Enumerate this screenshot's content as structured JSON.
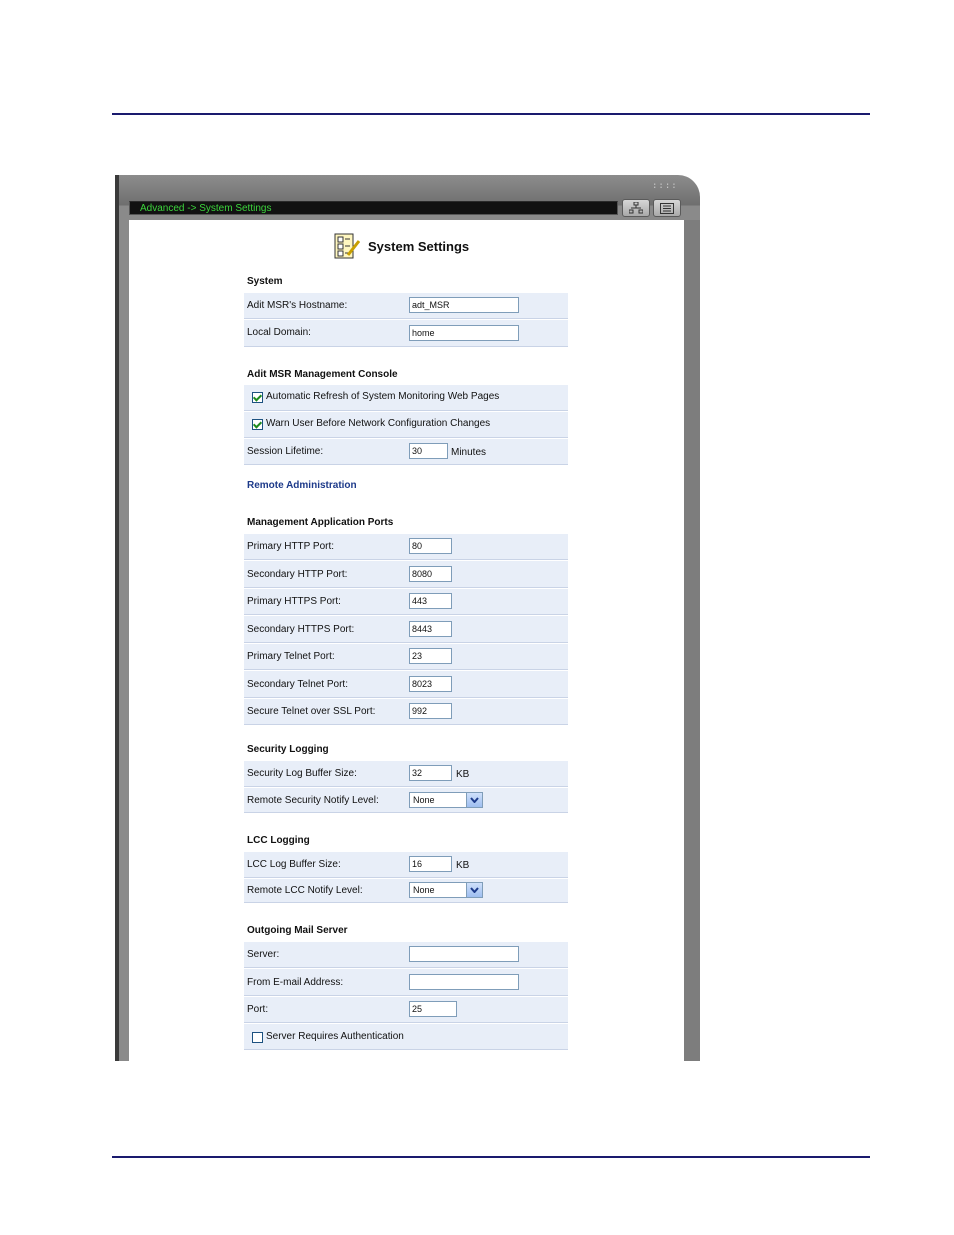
{
  "breadcrumb": "Advanced -> System Settings",
  "page_title": "System Settings",
  "window_grip": "::::",
  "sections": {
    "system": {
      "heading": "System",
      "hostname": {
        "label": "Adit MSR's Hostname:",
        "value": "adt_MSR"
      },
      "local_domain": {
        "label": "Local Domain:",
        "value": "home"
      }
    },
    "console": {
      "heading": "Adit MSR Management Console",
      "auto_refresh": {
        "label": "Automatic Refresh of System Monitoring Web Pages",
        "checked": true
      },
      "warn_user": {
        "label": "Warn User Before Network Configuration Changes",
        "checked": true
      },
      "session": {
        "label": "Session Lifetime:",
        "value": "30",
        "unit": "Minutes"
      }
    },
    "remote_admin": {
      "heading": "Remote Administration"
    },
    "ports": {
      "heading": "Management Application Ports",
      "rows": [
        {
          "label": "Primary HTTP Port:",
          "value": "80"
        },
        {
          "label": "Secondary HTTP Port:",
          "value": "8080"
        },
        {
          "label": "Primary HTTPS Port:",
          "value": "443"
        },
        {
          "label": "Secondary HTTPS Port:",
          "value": "8443"
        },
        {
          "label": "Primary Telnet Port:",
          "value": "23"
        },
        {
          "label": "Secondary Telnet Port:",
          "value": "8023"
        },
        {
          "label": "Secure Telnet over SSL Port:",
          "value": "992"
        }
      ]
    },
    "security_logging": {
      "heading": "Security Logging",
      "buffer": {
        "label": "Security Log Buffer Size:",
        "value": "32",
        "unit": "KB"
      },
      "notify": {
        "label": "Remote Security Notify Level:",
        "value": "None"
      }
    },
    "lcc_logging": {
      "heading": "LCC Logging",
      "buffer": {
        "label": "LCC Log Buffer Size:",
        "value": "16",
        "unit": "KB"
      },
      "notify": {
        "label": "Remote LCC Notify Level:",
        "value": "None"
      }
    },
    "mail": {
      "heading": "Outgoing Mail Server",
      "server": {
        "label": "Server:",
        "value": ""
      },
      "from": {
        "label": "From E-mail Address:",
        "value": ""
      },
      "port": {
        "label": "Port:",
        "value": "25"
      },
      "auth": {
        "label": "Server Requires Authentication",
        "checked": false
      }
    }
  },
  "colors": {
    "breadcrumb_text": "#3cd43c",
    "row_bg": "#e8eef8",
    "link": "#1d3a8a"
  }
}
